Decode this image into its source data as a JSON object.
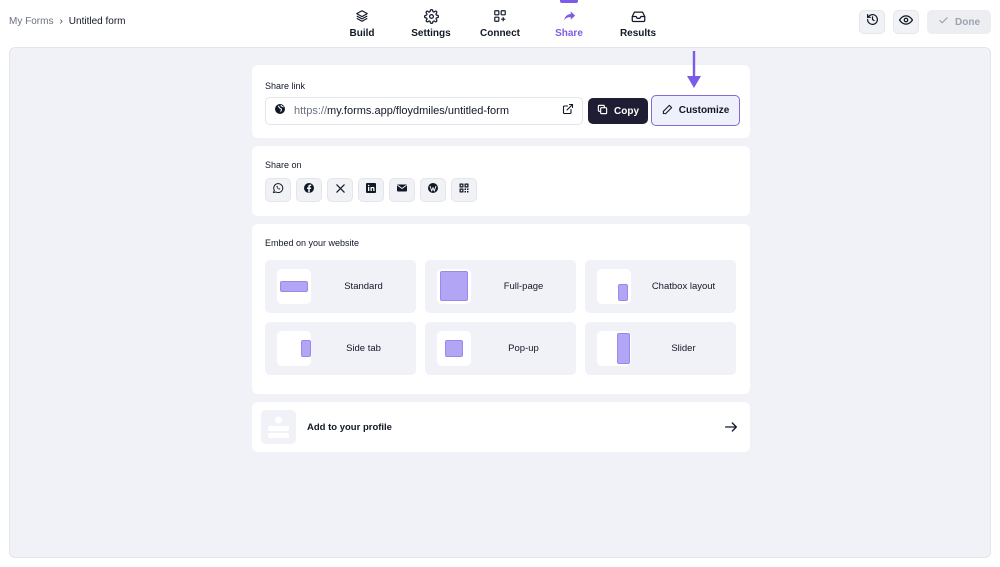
{
  "breadcrumb": {
    "parent": "My Forms",
    "separator": "›",
    "current": "Untitled form"
  },
  "nav": {
    "items": [
      {
        "label": "Build",
        "icon": "layers-icon"
      },
      {
        "label": "Settings",
        "icon": "gear-icon"
      },
      {
        "label": "Connect",
        "icon": "grid-plus-icon"
      },
      {
        "label": "Share",
        "icon": "share-arrow-icon",
        "active": true
      },
      {
        "label": "Results",
        "icon": "inbox-icon"
      }
    ]
  },
  "actions": {
    "history_icon": "history-icon",
    "preview_icon": "eye-icon",
    "done_label": "Done"
  },
  "share_link": {
    "title": "Share link",
    "url_protocol": "https://",
    "url_rest": "my.forms.app/floydmiles/untitled-form",
    "copy_label": "Copy",
    "customize_label": "Customize"
  },
  "share_on": {
    "title": "Share on",
    "platforms": [
      "whatsapp-icon",
      "facebook-icon",
      "x-icon",
      "linkedin-icon",
      "email-icon",
      "wordpress-icon",
      "qr-code-icon"
    ]
  },
  "embed": {
    "title": "Embed on your website",
    "options": [
      {
        "label": "Standard"
      },
      {
        "label": "Full-page"
      },
      {
        "label": "Chatbox layout"
      },
      {
        "label": "Side tab"
      },
      {
        "label": "Pop-up"
      },
      {
        "label": "Slider"
      }
    ]
  },
  "profile": {
    "label": "Add to your profile"
  },
  "colors": {
    "accent": "#7c5ce6",
    "copy_button": "#1f1d33",
    "canvas": "#f1f2f7",
    "embed_shape": "#b3a5f6"
  }
}
